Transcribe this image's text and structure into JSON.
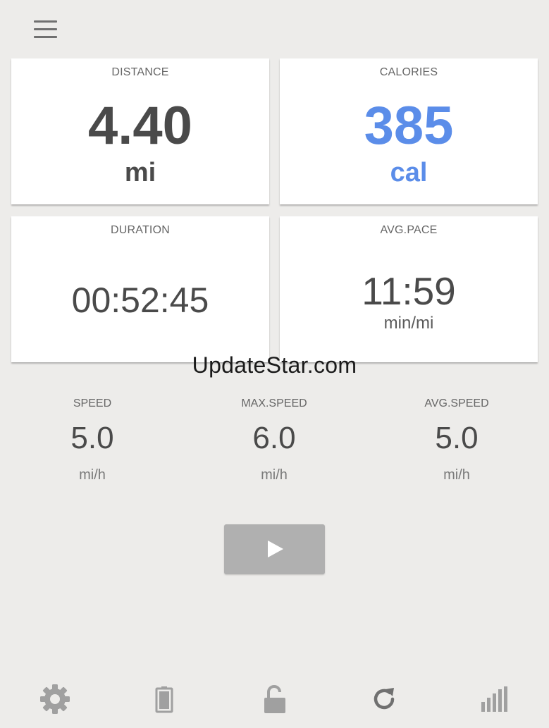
{
  "header": {
    "menu_icon": "hamburger-menu-icon"
  },
  "cards": {
    "distance": {
      "label": "DISTANCE",
      "value": "4.40",
      "unit": "mi"
    },
    "calories": {
      "label": "CALORIES",
      "value": "385",
      "unit": "cal"
    },
    "duration": {
      "label": "DURATION",
      "value": "00:52:45"
    },
    "avg_pace": {
      "label": "AVG.PACE",
      "value": "11:59",
      "unit": "min/mi"
    }
  },
  "watermark": "UpdateStar.com",
  "stats": {
    "speed": {
      "label": "SPEED",
      "value": "5.0",
      "unit": "mi/h"
    },
    "max_speed": {
      "label": "MAX.SPEED",
      "value": "6.0",
      "unit": "mi/h"
    },
    "avg_speed": {
      "label": "AVG.SPEED",
      "value": "5.0",
      "unit": "mi/h"
    }
  },
  "controls": {
    "play_icon": "play-icon"
  },
  "bottom_bar": [
    {
      "icon": "gear-icon"
    },
    {
      "icon": "battery-icon"
    },
    {
      "icon": "lock-icon"
    },
    {
      "icon": "refresh-icon"
    },
    {
      "icon": "bar-chart-icon"
    }
  ],
  "colors": {
    "background": "#edecea",
    "card": "#ffffff",
    "accent": "#5b8de9",
    "text": "#4a4a4a",
    "icon": "#a0a0a0",
    "play_button": "#b0b0b0"
  }
}
